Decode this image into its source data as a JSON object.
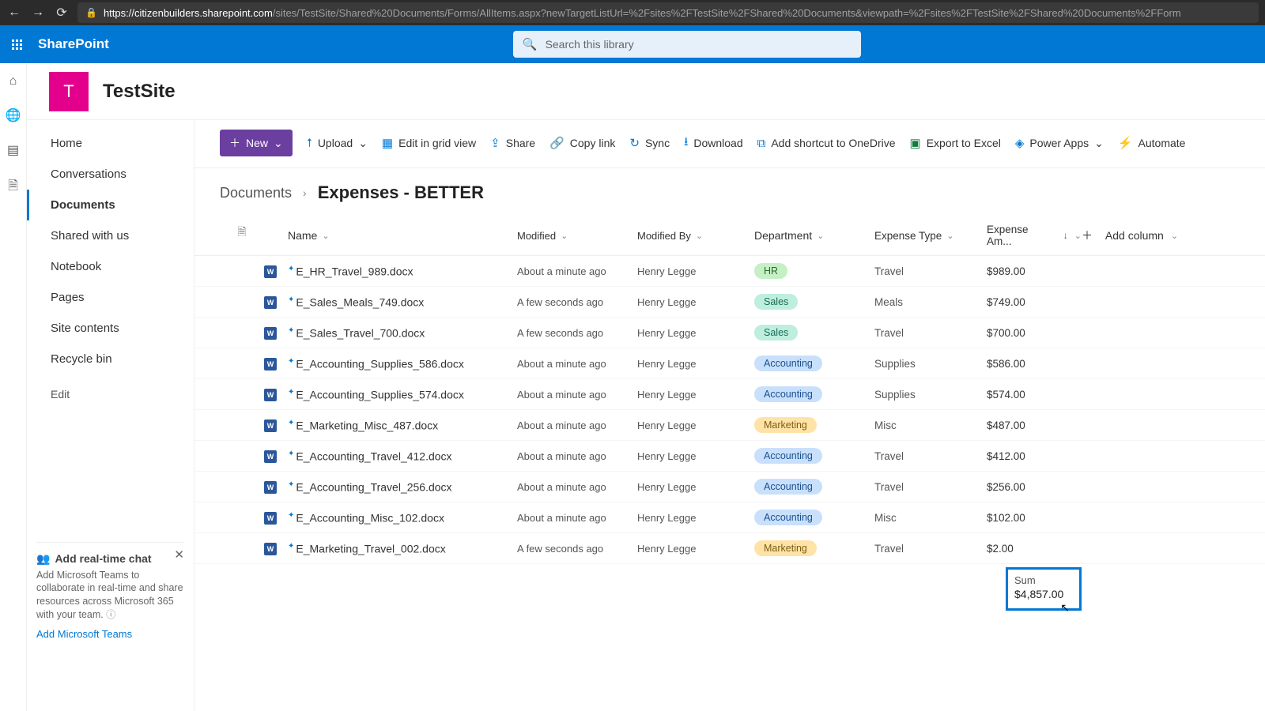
{
  "browser": {
    "url_domain": "https://citizenbuilders.sharepoint.com",
    "url_path": "/sites/TestSite/Shared%20Documents/Forms/AllItems.aspx?newTargetListUrl=%2Fsites%2FTestSite%2FShared%20Documents&viewpath=%2Fsites%2FTestSite%2FShared%20Documents%2FForm"
  },
  "sp": {
    "brand": "SharePoint",
    "search_placeholder": "Search this library"
  },
  "site": {
    "initial": "T",
    "name": "TestSite"
  },
  "nav": {
    "items": [
      "Home",
      "Conversations",
      "Documents",
      "Shared with us",
      "Notebook",
      "Pages",
      "Site contents",
      "Recycle bin"
    ],
    "edit": "Edit",
    "active_index": 2
  },
  "promo": {
    "title": "Add real-time chat",
    "desc": "Add Microsoft Teams to collaborate in real-time and share resources across Microsoft 365 with your team.",
    "link": "Add Microsoft Teams"
  },
  "cmd": {
    "new": "New",
    "upload": "Upload",
    "editgrid": "Edit in grid view",
    "share": "Share",
    "copylink": "Copy link",
    "sync": "Sync",
    "download": "Download",
    "shortcut": "Add shortcut to OneDrive",
    "export": "Export to Excel",
    "powerapps": "Power Apps",
    "automate": "Automate"
  },
  "crumbs": {
    "parent": "Documents",
    "current": "Expenses - BETTER"
  },
  "cols": {
    "name": "Name",
    "modified": "Modified",
    "modified_by": "Modified By",
    "department": "Department",
    "expense_type": "Expense Type",
    "expense_amt": "Expense Am...",
    "add": "Add column"
  },
  "rows": [
    {
      "name": "E_HR_Travel_989.docx",
      "modified": "About a minute ago",
      "by": "Henry Legge",
      "dept": "HR",
      "type": "Travel",
      "amt": "$989.00"
    },
    {
      "name": "E_Sales_Meals_749.docx",
      "modified": "A few seconds ago",
      "by": "Henry Legge",
      "dept": "Sales",
      "type": "Meals",
      "amt": "$749.00"
    },
    {
      "name": "E_Sales_Travel_700.docx",
      "modified": "A few seconds ago",
      "by": "Henry Legge",
      "dept": "Sales",
      "type": "Travel",
      "amt": "$700.00"
    },
    {
      "name": "E_Accounting_Supplies_586.docx",
      "modified": "About a minute ago",
      "by": "Henry Legge",
      "dept": "Accounting",
      "type": "Supplies",
      "amt": "$586.00"
    },
    {
      "name": "E_Accounting_Supplies_574.docx",
      "modified": "About a minute ago",
      "by": "Henry Legge",
      "dept": "Accounting",
      "type": "Supplies",
      "amt": "$574.00"
    },
    {
      "name": "E_Marketing_Misc_487.docx",
      "modified": "About a minute ago",
      "by": "Henry Legge",
      "dept": "Marketing",
      "type": "Misc",
      "amt": "$487.00"
    },
    {
      "name": "E_Accounting_Travel_412.docx",
      "modified": "About a minute ago",
      "by": "Henry Legge",
      "dept": "Accounting",
      "type": "Travel",
      "amt": "$412.00"
    },
    {
      "name": "E_Accounting_Travel_256.docx",
      "modified": "About a minute ago",
      "by": "Henry Legge",
      "dept": "Accounting",
      "type": "Travel",
      "amt": "$256.00"
    },
    {
      "name": "E_Accounting_Misc_102.docx",
      "modified": "About a minute ago",
      "by": "Henry Legge",
      "dept": "Accounting",
      "type": "Misc",
      "amt": "$102.00"
    },
    {
      "name": "E_Marketing_Travel_002.docx",
      "modified": "A few seconds ago",
      "by": "Henry Legge",
      "dept": "Marketing",
      "type": "Travel",
      "amt": "$2.00"
    }
  ],
  "sum": {
    "label": "Sum",
    "value": "$4,857.00"
  }
}
